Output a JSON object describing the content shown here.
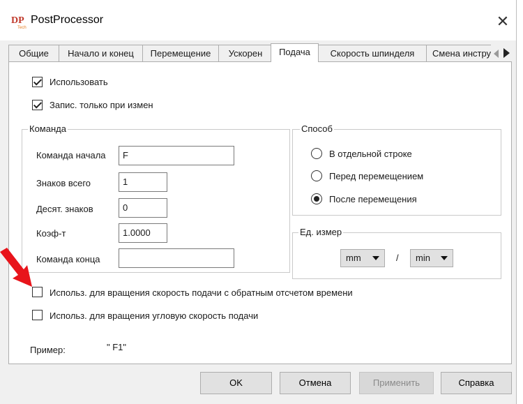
{
  "window": {
    "title": "PostProcessor",
    "close_glyph": "✕",
    "logo_icon": "dp-logo-icon"
  },
  "tabs": [
    {
      "label": "Общие"
    },
    {
      "label": "Начало и конец"
    },
    {
      "label": "Перемещение"
    },
    {
      "label": "Ускорен"
    },
    {
      "label": "Подача",
      "active": true
    },
    {
      "label": "Скорость шпинделя"
    },
    {
      "label": "Смена инструмен"
    }
  ],
  "options": {
    "use_label": "Использовать",
    "use_checked": true,
    "write_on_change_label": "Запис. только при измен",
    "write_on_change_checked": true
  },
  "command_group": {
    "title": "Команда",
    "start_label": "Команда начала",
    "start_value": "F",
    "total_digits_label": "Знаков всего",
    "total_digits_value": "1",
    "decimal_digits_label": "Десят. знаков",
    "decimal_digits_value": "0",
    "coef_label": "Коэф-т",
    "coef_value": "1.0000",
    "end_label": "Команда конца",
    "end_value": ""
  },
  "method_group": {
    "title": "Способ",
    "options": [
      {
        "label": "В отдельной строке",
        "selected": false
      },
      {
        "label": "Перед перемещением",
        "selected": false
      },
      {
        "label": "После перемещения",
        "selected": true
      }
    ]
  },
  "units_group": {
    "title": "Ед. измер",
    "unit1": "mm",
    "separator": "/",
    "unit2": "min"
  },
  "rotation_options": {
    "inverse_time_label": "Использ. для вращения  скорость подачи с обратным отсчетом времени",
    "inverse_time_checked": false,
    "angular_label": "Использ. для вращения угловую скорость подачи",
    "angular_checked": false
  },
  "example": {
    "label": "Пример:",
    "value": "\" F1\""
  },
  "buttons": {
    "ok": "OK",
    "cancel": "Отмена",
    "apply": "Применить",
    "help": "Справка"
  },
  "colors": {
    "annotation_arrow": "#e8141b",
    "window_bg": "#f0f0f0",
    "pane_bg": "#ffffff"
  }
}
